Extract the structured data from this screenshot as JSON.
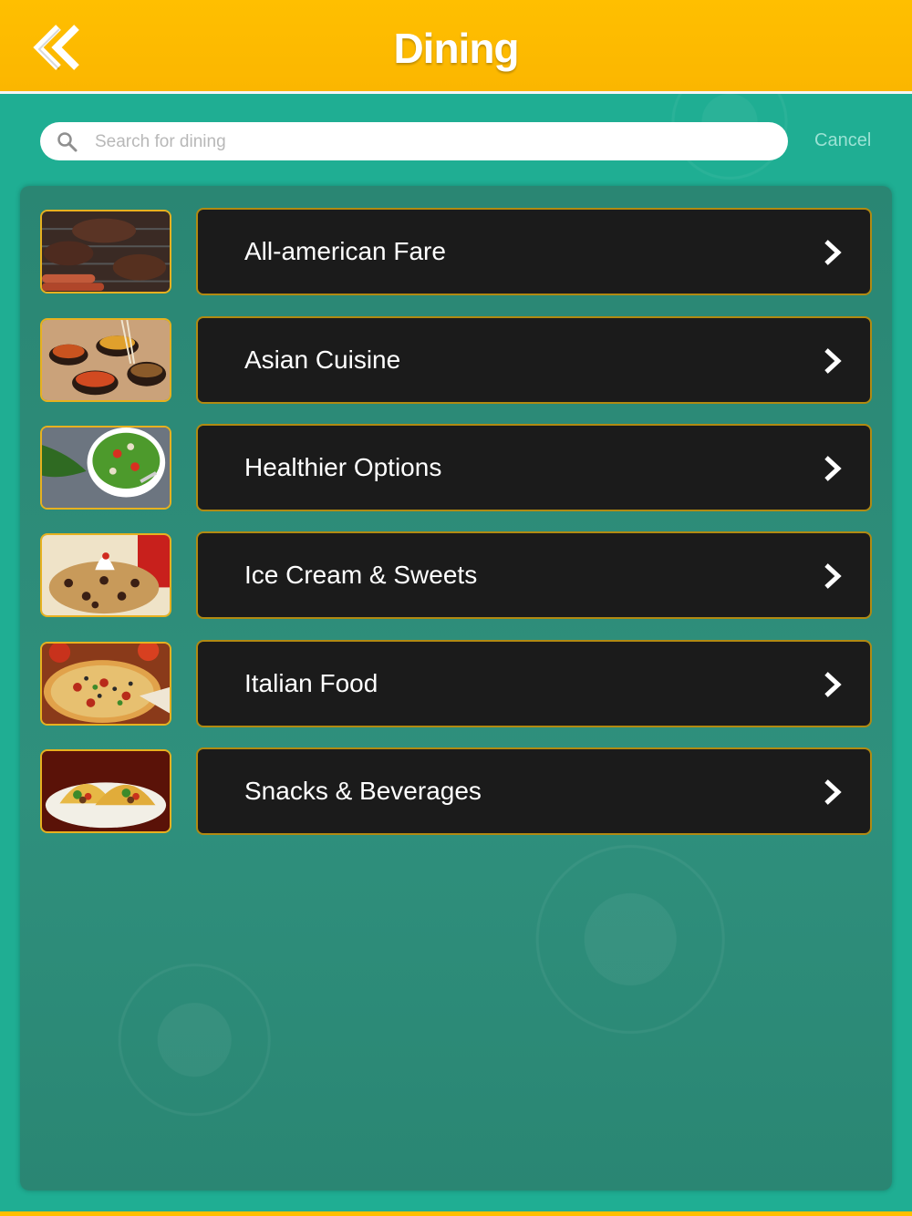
{
  "header": {
    "title": "Dining",
    "back_icon": "double-chevron-left-icon"
  },
  "search": {
    "placeholder": "Search for dining",
    "value": "",
    "cancel_label": "Cancel"
  },
  "categories": [
    {
      "label": "All-american Fare",
      "image": "grilled-burgers-image"
    },
    {
      "label": "Asian Cuisine",
      "image": "asian-bowls-image"
    },
    {
      "label": "Healthier Options",
      "image": "salad-bowl-image"
    },
    {
      "label": "Ice Cream & Sweets",
      "image": "ice-cream-sundae-image"
    },
    {
      "label": "Italian Food",
      "image": "pizza-image"
    },
    {
      "label": "Snacks & Beverages",
      "image": "tacos-image"
    }
  ],
  "colors": {
    "header": "#ffbf00",
    "background": "#1fae93",
    "panel": "#2e8f7c",
    "button": "#1b1b1b",
    "border_gold": "#e7b11f"
  }
}
